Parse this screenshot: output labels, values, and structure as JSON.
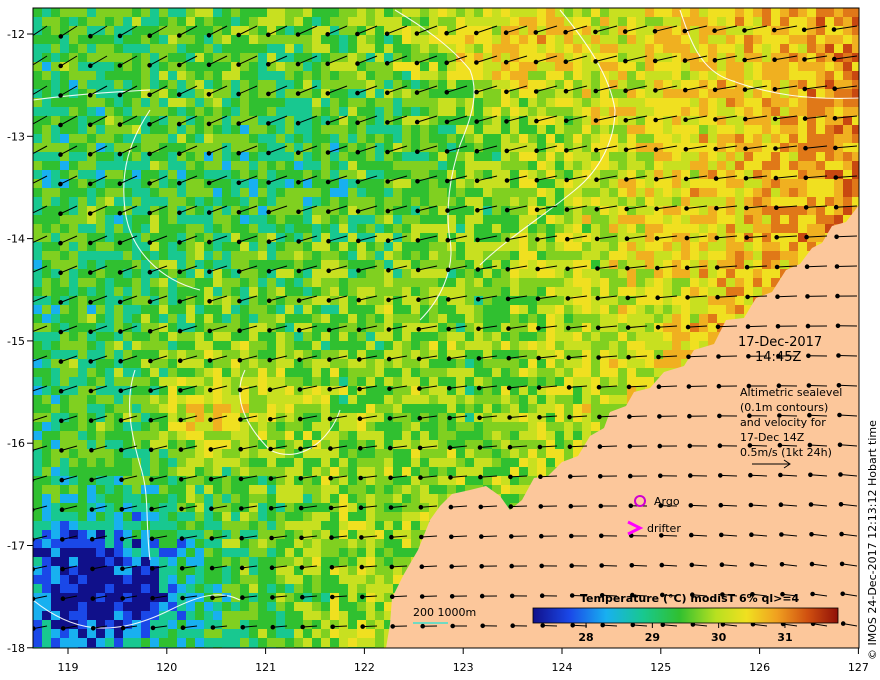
{
  "map": {
    "x_ticks": [
      "119",
      "120",
      "121",
      "122",
      "123",
      "124",
      "125",
      "126",
      "127"
    ],
    "y_ticks": [
      "-12",
      "-13",
      "-14",
      "-15",
      "-16",
      "-17",
      "-18"
    ],
    "date": "17-Dec-2017",
    "time": "14:45Z",
    "info_lines": [
      "Altimetric sealevel",
      "(0.1m contours)",
      "and velocity for",
      "17-Dec 14Z",
      "0.5m/s (1kt 24h)"
    ],
    "argo_label": "Argo",
    "drifter_label": "drifter",
    "bathy_label": "200  1000m",
    "colorbar_title": "Temperature (°C) modisT 6% ql>=4",
    "colorbar_ticks": [
      "28",
      "29",
      "30",
      "31"
    ],
    "colorbar_range": [
      27.2,
      31.8
    ],
    "credit": "© IMOS 24-Dec-2017 12:13:12 Hobart time",
    "colors": {
      "land": "#fcc79b",
      "argo": "#d000d0",
      "drifter": "#ff00ff",
      "bathy": "#40e0d0",
      "contour": "#ffffff"
    }
  }
}
